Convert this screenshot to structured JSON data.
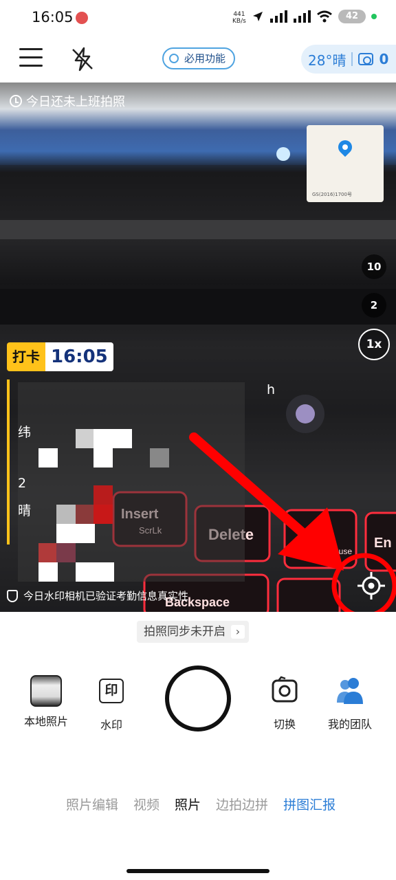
{
  "status_bar": {
    "time": "16:05",
    "net_speed_value": "441",
    "net_speed_unit": "KB/s",
    "battery": "42"
  },
  "header": {
    "function_button": "必用功能",
    "weather": "28°晴",
    "photo_count": "0"
  },
  "viewfinder": {
    "today_notice": "今日还未上班拍照",
    "map_caption": "GS(2016)1700号",
    "zoom_levels": [
      "10",
      "2",
      "1x"
    ],
    "punch_tag": "打卡",
    "punch_time": "16:05",
    "watermark_fragments": [
      "h",
      "纬",
      "2",
      "晴"
    ],
    "verify_notice": "今日水印相机已验证考勤信息真实性",
    "keycaps": {
      "insert": "Insert",
      "scrlk": "ScrLk",
      "delete": "Delete",
      "end": "En",
      "backspace": "Backspace",
      "pause": "Pause",
      "e": "e"
    }
  },
  "sync_notice": "拍照同步未开启",
  "controls": {
    "local_photos": "本地照片",
    "watermark": "水印",
    "watermark_icon_char": "印",
    "switch": "切换",
    "my_team": "我的团队"
  },
  "mode_tabs": [
    "照片编辑",
    "视频",
    "照片",
    "边拍边拼",
    "拼图汇报"
  ],
  "colors": {
    "accent_blue": "#2b7dd6",
    "punch_yellow": "#ffc21a",
    "annotation_red": "#ff0000"
  }
}
